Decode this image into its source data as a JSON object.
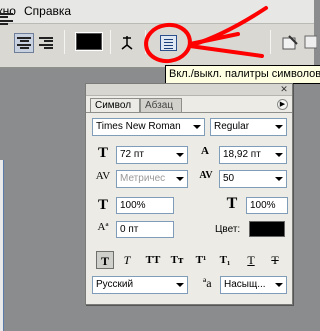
{
  "menubar": {
    "items": [
      {
        "label": "Окно"
      },
      {
        "label": "Справка"
      }
    ]
  },
  "toolbar": {
    "text_color": "#000000"
  },
  "tooltip": {
    "text": "Вкл./выкл. палитры символов"
  },
  "annotation": {
    "color": "#ff0000"
  },
  "panel": {
    "tabs": [
      {
        "label": "Символ",
        "active": true
      },
      {
        "label": "Абзац",
        "active": false
      }
    ],
    "font_family": "Times New Roman",
    "font_style": "Regular",
    "font_size": "72 пт",
    "leading": "18,92 пт",
    "kerning": "Метричес",
    "tracking": "50",
    "vertical_scale": "100%",
    "horizontal_scale": "100%",
    "baseline_shift": "0 пт",
    "color_label": "Цвет:",
    "color_value": "#000000",
    "style_buttons": [
      "T",
      "T",
      "TT",
      "Tт",
      "T¹",
      "T₁",
      "T",
      "T"
    ],
    "language": "Русский",
    "antialias": "Насыщ..."
  }
}
